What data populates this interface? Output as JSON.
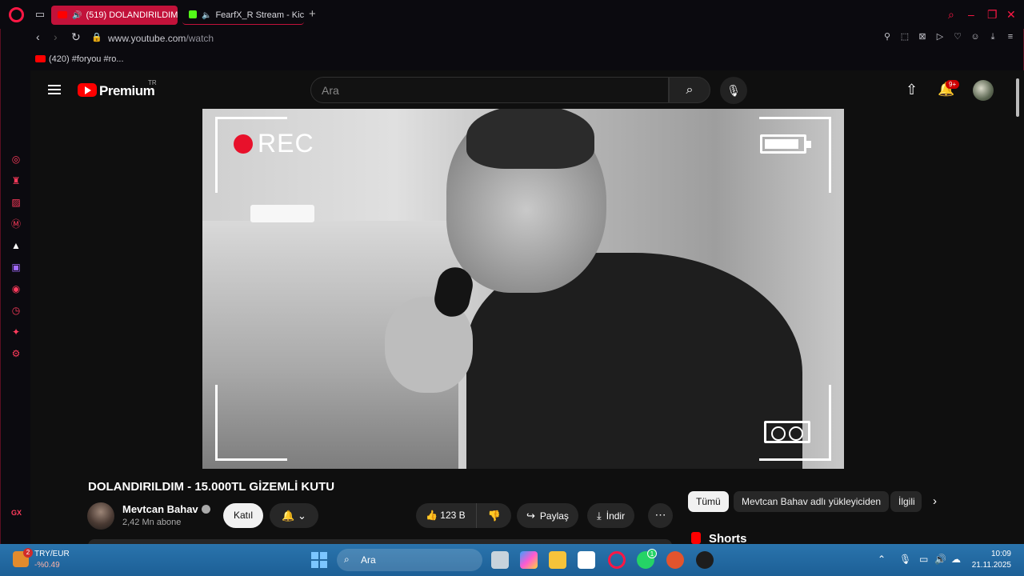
{
  "browser": {
    "tabs": [
      {
        "label": "(519) DOLANDIRILDIM"
      },
      {
        "label": "FearfX_R Stream - Kick"
      }
    ],
    "new_tab_symbol": "+",
    "url_host": "www.youtube.com",
    "url_path": "/watch",
    "bookmark": "(420) #foryou #ro..."
  },
  "youtube": {
    "brand": "Premium",
    "region": "TR",
    "search_placeholder": "Ara",
    "notification_count": "9+",
    "video": {
      "rec_label": "REC",
      "title": "DOLANDIRILDIM - 15.000TL GİZEMLİ KUTU"
    },
    "channel": {
      "name": "Mevtcan Bahav",
      "subscribers": "2,42 Mn abone"
    },
    "actions": {
      "join": "Katıl",
      "likes": "123 B",
      "share": "Paylaş",
      "download": "İndir"
    },
    "chips": [
      "Tümü",
      "Mevtcan Bahav adlı yükleyiciden",
      "İlgili"
    ],
    "shorts_heading": "Shorts"
  },
  "taskbar": {
    "ticker_name": "TRY/EUR",
    "ticker_value": "-%0.49",
    "ticker_badge": "2",
    "search_label": "Ara",
    "whatsapp_badge": "1",
    "time": "10:09",
    "date": "21.11.2025"
  },
  "colors": {
    "opera_accent": "#ff1744",
    "active_tab": "#c2123a",
    "youtube_red": "#ff0000",
    "taskbar": "#1c5f96"
  },
  "icons": [
    "opera-logo",
    "speaker-icon",
    "back-icon",
    "forward-icon",
    "reload-icon",
    "lock-icon",
    "search-icon",
    "mic-icon",
    "upload-icon",
    "bell-icon",
    "like-icon",
    "dislike-icon",
    "share-icon",
    "download-icon",
    "more-icon",
    "chevron-right-icon"
  ]
}
